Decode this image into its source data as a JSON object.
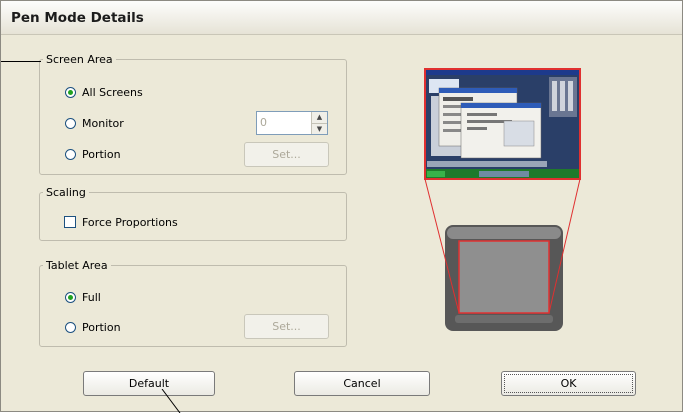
{
  "window": {
    "title": "Pen Mode Details"
  },
  "screen_area": {
    "legend": "Screen Area",
    "options": [
      {
        "label": "All Screens",
        "selected": true
      },
      {
        "label": "Monitor",
        "selected": false
      },
      {
        "label": "Portion",
        "selected": false
      }
    ],
    "monitor_value": "0",
    "set_label": "Set..."
  },
  "scaling": {
    "legend": "Scaling",
    "force_proportions_label": "Force Proportions",
    "force_proportions_checked": false
  },
  "tablet_area": {
    "legend": "Tablet Area",
    "options": [
      {
        "label": "Full",
        "selected": true
      },
      {
        "label": "Portion",
        "selected": false
      }
    ],
    "set_label": "Set..."
  },
  "buttons": {
    "default_label": "Default",
    "cancel_label": "Cancel",
    "ok_label": "OK"
  },
  "colors": {
    "dialog_bg": "#ece9d8",
    "mapping_outline": "#e03030",
    "radio_selected": "#21a121"
  }
}
